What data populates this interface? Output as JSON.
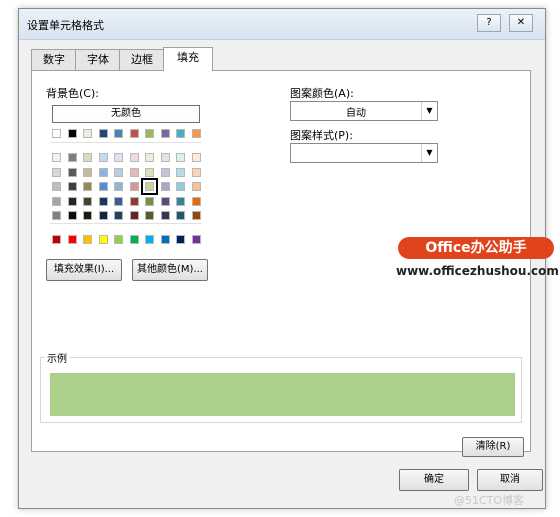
{
  "dialog": {
    "title": "设置单元格格式",
    "help_btn": "?",
    "close_btn": "✕"
  },
  "tabs": [
    {
      "label": "数字",
      "active": false
    },
    {
      "label": "字体",
      "active": false
    },
    {
      "label": "边框",
      "active": false
    },
    {
      "label": "填充",
      "active": true
    }
  ],
  "fill": {
    "background_label": "背景色(C):",
    "no_color_label": "无颜色",
    "fill_effects_label": "填充效果(I)...",
    "more_colors_label": "其他颜色(M)...",
    "pattern_color_label": "图案颜色(A):",
    "pattern_color_value": "自动",
    "pattern_style_label": "图案样式(P):",
    "pattern_style_value": "",
    "sample_label": "示例",
    "sample_color": "#acd08b",
    "clear_label": "清除(R)",
    "theme_top_row": [
      "#ffffff",
      "#000000",
      "#eeece1",
      "#1f497d",
      "#4f81bd",
      "#c0504d",
      "#9bbb59",
      "#8064a2",
      "#4bacc6",
      "#f79646"
    ],
    "tint_rows": [
      [
        "#f2f2f2",
        "#7f7f7f",
        "#ddd9c3",
        "#c6d9f0",
        "#dbe5f1",
        "#f2dcdb",
        "#ebf1dd",
        "#e5e0ec",
        "#dbeef3",
        "#fdeada"
      ],
      [
        "#d8d8d8",
        "#595959",
        "#c4bd97",
        "#8db3e2",
        "#b8cce4",
        "#e5b9b7",
        "#d7e3bc",
        "#ccc1d9",
        "#b7dde8",
        "#fbd5b5"
      ],
      [
        "#bfbfbf",
        "#3f3f3f",
        "#938953",
        "#548dd4",
        "#95b3d7",
        "#d99694",
        "#c3d69b",
        "#b2a2c7",
        "#92cddc",
        "#fac08f"
      ],
      [
        "#a5a5a5",
        "#262626",
        "#494429",
        "#17365d",
        "#366092",
        "#953734",
        "#76923c",
        "#5f497a",
        "#31859b",
        "#e36c09"
      ],
      [
        "#7f7f7f",
        "#0c0c0c",
        "#1d1b10",
        "#0f243e",
        "#244061",
        "#632423",
        "#4f6128",
        "#3f3151",
        "#205867",
        "#974806"
      ]
    ],
    "standard_row": [
      "#c00000",
      "#ff0000",
      "#ffc000",
      "#ffff00",
      "#92d050",
      "#00b050",
      "#00b0f0",
      "#0070c0",
      "#002060",
      "#7030a0"
    ],
    "selected": "tint row 2, column 7"
  },
  "buttons": {
    "ok_label": "确定",
    "cancel_label": "取消"
  },
  "overlay": {
    "badge_text": "Office办公助手",
    "badge_url": "www.officezhushou.com",
    "watermark": "@51CTO博客"
  }
}
